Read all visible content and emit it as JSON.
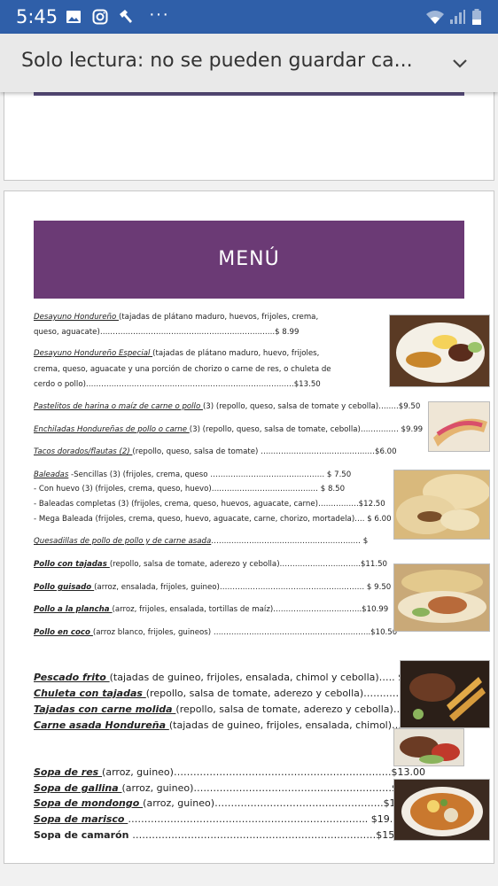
{
  "status_bar": {
    "time": "5:45",
    "icons": [
      "image-icon",
      "instagram-icon",
      "hammer-icon",
      "more-dots-icon",
      "wifi-icon",
      "signal-icon",
      "battery-icon"
    ],
    "dots": "···"
  },
  "app_bar": {
    "title": "Solo lectura: no se pueden guardar ca...",
    "chevron_icon": "chevron-down-icon"
  },
  "menu": {
    "banner": "MENÚ",
    "accent_color": "#6b3a75",
    "items": [
      {
        "name": "Desayuno Hondureño ",
        "desc": "(tajadas de plátano maduro, huevos, frijoles, crema,"
      },
      {
        "name": "",
        "desc": "queso, aguacate)……………………………………………………….…..$ 8.99"
      },
      {
        "name": "Desayuno Hondureño Especial ",
        "desc": "(tajadas de plátano maduro, huevo, frijoles,"
      },
      {
        "name": "",
        "desc": "crema, queso, aguacate y una porción de chorizo o carne de res, o chuleta de"
      },
      {
        "name": "",
        "desc": "cerdo o pollo)……………………………………………………………………….$13.50"
      },
      {
        "name": "Pastelitos de harina o maíz de carne o pollo ",
        "desc": "(3) (repollo, queso, salsa de tomate y cebolla)……..$9.50"
      },
      {
        "name": "Enchiladas Hondureñas de pollo o carne ",
        "desc": "(3) (repollo, queso, salsa de tomate, cebolla)…………… $9.99"
      },
      {
        "name": "Tacos dorados/flautas (2) ",
        "desc": "(repollo, queso, salsa de tomate) ………………………………………$6.00"
      },
      {
        "name": "Baleadas",
        "desc": "  -Sencillas (3) (frijoles, crema, queso ……………………………………… $ 7.50"
      },
      {
        "name": "",
        "desc": "- Con huevo (3) (frijoles, crema, queso, huevo)…………………………………… $ 8.50"
      },
      {
        "name": "",
        "desc": "- Baleadas completas (3) (frijoles, crema, queso, huevos, aguacate, carne)…………….$12.50"
      },
      {
        "name": "",
        "desc": "- Mega Baleada (frijoles, crema, queso, huevo, aguacate, carne, chorizo, mortadela)…. $ 6.00"
      },
      {
        "name": "Quesadillas de pollo de pollo y de carne asada",
        "desc": "……..…………………………………………… $"
      },
      {
        "name": "Pollo con tajadas ",
        "desc": "(repollo, salsa de tomate, aderezo y cebolla)…………………………..$11.50"
      },
      {
        "name": "Pollo guisado ",
        "desc": "(arroz, ensalada, frijoles, guineo)………………………………………………… $  9.50"
      },
      {
        "name": "Pollo a la plancha ",
        "desc": "(arroz, frijoles, ensalada, tortillas de maíz)……………………………..$10.99"
      },
      {
        "name": "Pollo en coco ",
        "desc": "(arroz blanco, frijoles, guineos) ……………………………………………………..$10.50"
      },
      {
        "name": "Pescado frito ",
        "desc": " (tajadas de guineo, frijoles, ensalada, chimol y cebolla)…..  $12.50"
      },
      {
        "name": "Chuleta con tajadas ",
        "desc": "(repollo, salsa de tomate, aderezo y cebolla)……..…  $12.50"
      },
      {
        "name": "Tajadas con carne molida ",
        "desc": "(repollo, salsa de tomate, aderezo y cebolla)…$12.00"
      },
      {
        "name": "Carne asada Hondureña ",
        "desc": "(tajadas de guineo, frijoles, ensalada, chimol)….$13.50"
      },
      {
        "name": "Sopa de res ",
        "desc": "(arroz, guineo)………………………………………………………….$13.00"
      },
      {
        "name": "Sopa de gallina ",
        "desc": "(arroz, guineo)…………………………………………………….$12.00"
      },
      {
        "name": "Sopa de mondongo ",
        "desc": "(arroz, guineo)…………………………………………….$13.00"
      },
      {
        "name": "Sopa de marisco ",
        "desc": "……………………………………………………………….. $19.00"
      },
      {
        "name": "Sopa de camarón ",
        "desc": "…………………………………………………………………$15.00"
      }
    ]
  }
}
